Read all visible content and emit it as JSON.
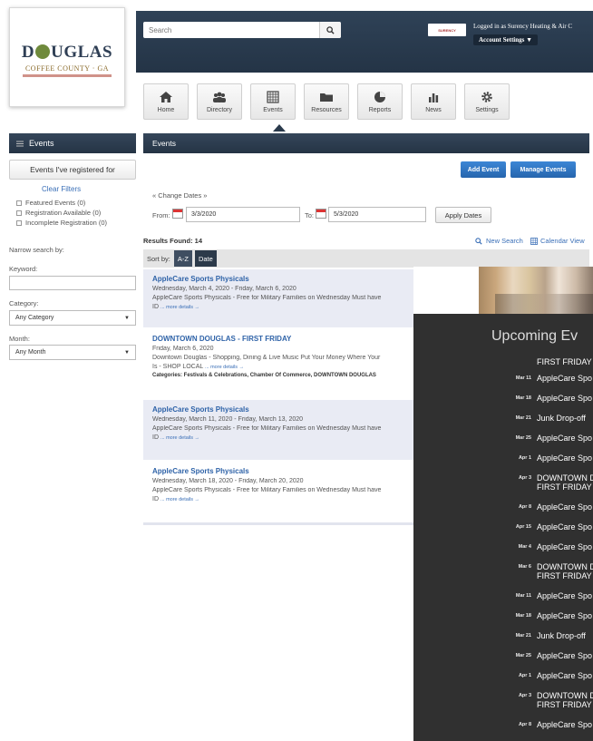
{
  "logo": {
    "main": "DOUGLAS",
    "sub": "COFFEE COUNTY · GA"
  },
  "header": {
    "search_placeholder": "Search",
    "account_badge": "SURENCY",
    "account_text": "Logged in as Surency Heating & Air C",
    "account_settings": "Account Settings ▼"
  },
  "nav": [
    {
      "label": "Home",
      "icon": "home-icon"
    },
    {
      "label": "Directory",
      "icon": "directory-icon"
    },
    {
      "label": "Events",
      "icon": "calendar-icon"
    },
    {
      "label": "Resources",
      "icon": "folder-icon"
    },
    {
      "label": "Reports",
      "icon": "pie-chart-icon"
    },
    {
      "label": "News",
      "icon": "news-icon"
    },
    {
      "label": "Settings",
      "icon": "gear-icon"
    }
  ],
  "sidebar": {
    "title": "Events",
    "registered": "Events I've registered for",
    "clear_filters": "Clear Filters",
    "filters": [
      "Featured Events (0)",
      "Registration Available (0)",
      "Incomplete Registration (0)"
    ],
    "narrow": "Narrow search by:",
    "keyword_label": "Keyword:",
    "category_label": "Category:",
    "category_value": "Any Category",
    "month_label": "Month:",
    "month_value": "Any Month"
  },
  "main": {
    "title": "Events",
    "add_event": "Add Event",
    "manage_events": "Manage Events",
    "change_dates": "« Change Dates »",
    "from_label": "From:",
    "from_value": "3/3/2020",
    "to_label": "To:",
    "to_value": "5/3/2020",
    "apply_dates": "Apply Dates",
    "results": "Results Found: 14",
    "new_search": "New Search",
    "calendar_view": "Calendar View",
    "sort_label": "Sort by:",
    "sort_az": "A-Z",
    "sort_date": "Date",
    "events": [
      {
        "title": "AppleCare Sports Physicals",
        "dates": "Wednesday, March 4, 2020 - Friday, March 6, 2020",
        "desc": "AppleCare Sports Physicals - Free for Military Families on Wednesday Must have",
        "desc2": "ID",
        "more": "... more details →"
      },
      {
        "title": "DOWNTOWN DOUGLAS - FIRST FRIDAY",
        "dates": "Friday, March 6, 2020",
        "desc": "Downtown Douglas - Shopping, Dining & Live Music Put Your Money Where Your",
        "desc2": "Is - SHOP LOCAL",
        "more": "... more details →",
        "cats": "Categories: Festivals & Celebrations, Chamber Of Commerce, DOWNTOWN DOUGLAS"
      },
      {
        "title": "AppleCare Sports Physicals",
        "dates": "Wednesday, March 11, 2020 - Friday, March 13, 2020",
        "desc": "AppleCare Sports Physicals - Free for Military Families on Wednesday Must have",
        "desc2": "ID",
        "more": "... more details →"
      },
      {
        "title": "AppleCare Sports Physicals",
        "dates": "Wednesday, March 18, 2020 - Friday, March 20, 2020",
        "desc": "AppleCare Sports Physicals - Free for Military Families on Wednesday Must have",
        "desc2": "ID",
        "more": "... more details →"
      }
    ]
  },
  "upcoming": {
    "title": "Upcoming Ev",
    "first_line": "FIRST FRIDAY",
    "items": [
      {
        "date": "Mar 11",
        "text": "AppleCare Spo"
      },
      {
        "date": "Mar 18",
        "text": "AppleCare Spo"
      },
      {
        "date": "Mar 21",
        "text": "Junk Drop-off"
      },
      {
        "date": "Mar 25",
        "text": "AppleCare Spo"
      },
      {
        "date": "Apr 1",
        "text": "AppleCare Spo"
      },
      {
        "date": "Apr 3",
        "text": "DOWNTOWN D",
        "text2": "FIRST FRIDAY"
      },
      {
        "date": "Apr 8",
        "text": "AppleCare Spo"
      },
      {
        "date": "Apr 15",
        "text": "AppleCare Spo"
      },
      {
        "date": "Mar 4",
        "text": "AppleCare Spo"
      },
      {
        "date": "Mar 6",
        "text": "DOWNTOWN D",
        "text2": "FIRST FRIDAY"
      },
      {
        "date": "Mar 11",
        "text": "AppleCare Spo"
      },
      {
        "date": "Mar 18",
        "text": "AppleCare Spo"
      },
      {
        "date": "Mar 21",
        "text": "Junk Drop-off"
      },
      {
        "date": "Mar 25",
        "text": "AppleCare Spo"
      },
      {
        "date": "Apr 1",
        "text": "AppleCare Spo"
      },
      {
        "date": "Apr 3",
        "text": "DOWNTOWN D",
        "text2": "FIRST FRIDAY"
      },
      {
        "date": "Apr 8",
        "text": "AppleCare Spo"
      }
    ]
  }
}
